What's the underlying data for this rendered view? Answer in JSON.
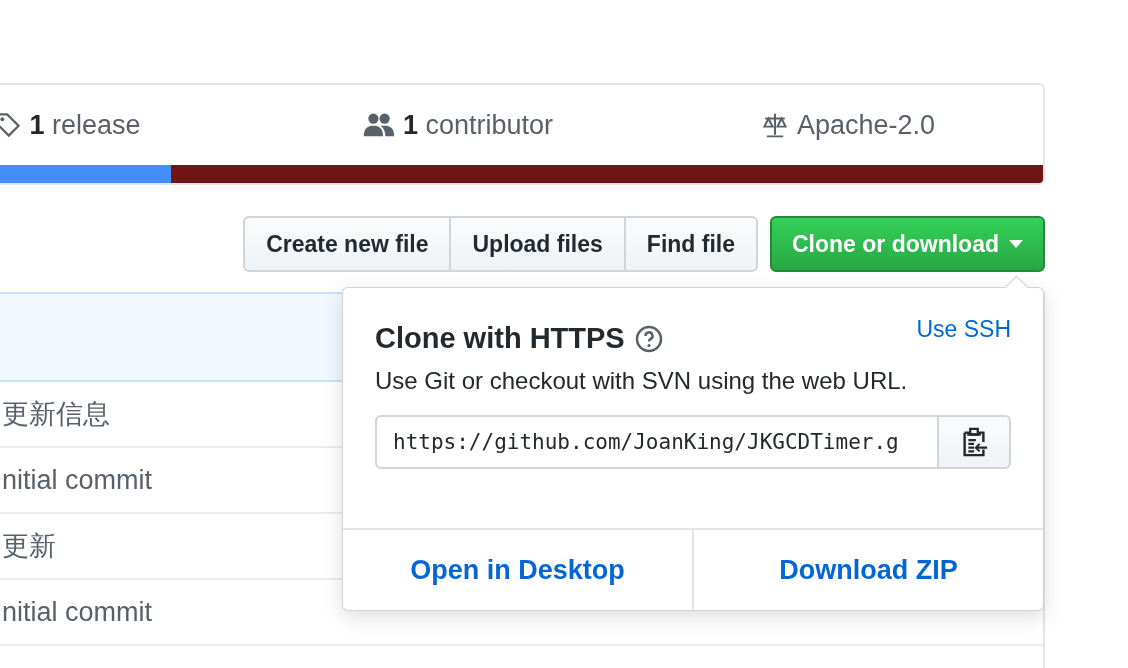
{
  "summary": {
    "stats": [
      {
        "kind": "tag",
        "count": "1",
        "label": "release"
      },
      {
        "kind": "people",
        "count": "1",
        "label": "contributor"
      },
      {
        "kind": "scale",
        "label": "Apache-2.0"
      }
    ],
    "languages": [
      {
        "color": "#438eff",
        "level": 0.17
      },
      {
        "color": "#701516",
        "level": 0.83
      }
    ]
  },
  "actions": {
    "buttons": [
      "Create new file",
      "Upload files",
      "Find file"
    ],
    "primary": "Clone or download"
  },
  "files": [
    {
      "message": "更新信息"
    },
    {
      "message": "nitial commit"
    },
    {
      "message": "更新"
    },
    {
      "message": "nitial commit"
    }
  ],
  "clone_popup": {
    "title": "Clone with HTTPS",
    "switch_link": "Use SSH",
    "description": "Use Git or checkout with SVN using the web URL.",
    "url": "https://github.com/JoanKing/JKGCDTimer.g",
    "actions": [
      "Open in Desktop",
      "Download ZIP"
    ]
  }
}
